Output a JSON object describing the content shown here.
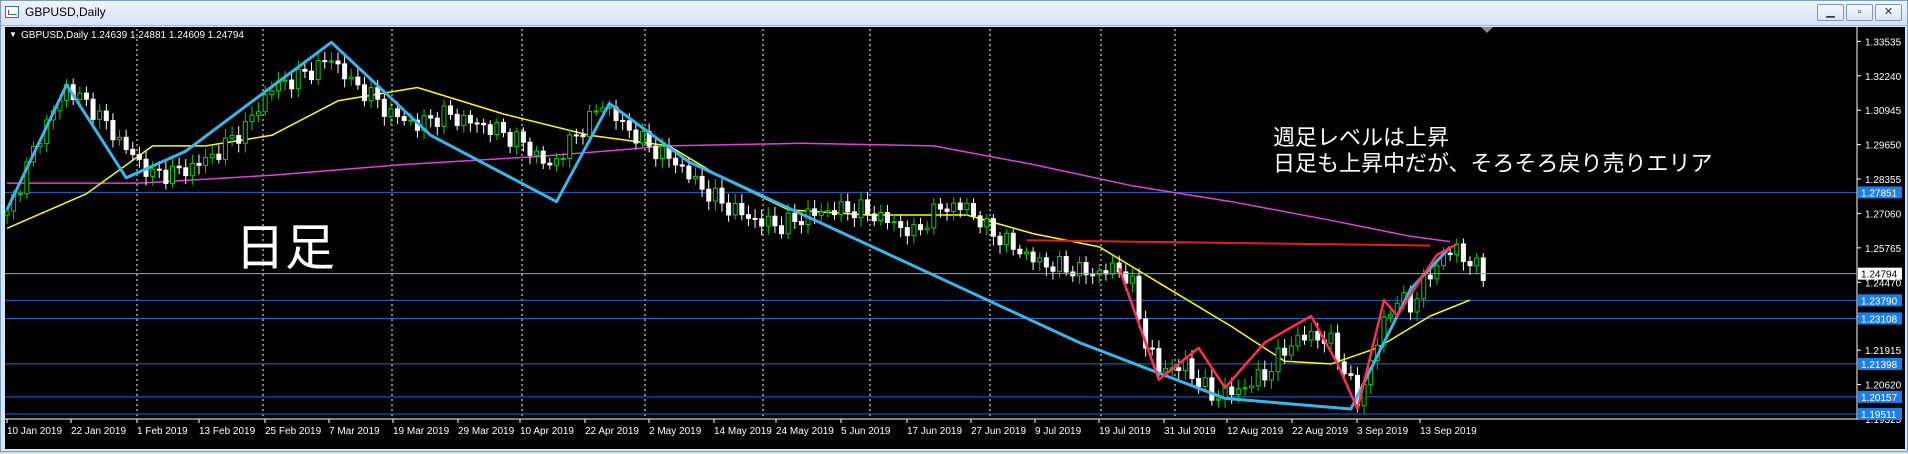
{
  "window": {
    "title": "GBPUSD,Daily",
    "minimize_icon": "minimize-icon",
    "maximize_icon": "maximize-icon",
    "close_icon": "close-icon"
  },
  "chart_data": {
    "type": "line",
    "symbol_header": "GBPUSD,Daily  1.24639 1.24881 1.24609 1.24794",
    "header_arrow_icon": "triangle-down-icon",
    "annotations": {
      "big_label": "日足",
      "note_line1": "週足レベルは上昇",
      "note_line2": "日足も上昇中だが、そろそろ戻り売りエリア"
    },
    "y_axis_ticks": [
      "1.33535",
      "1.32240",
      "1.30945",
      "1.29650",
      "1.28355",
      "1.27060",
      "1.25765",
      "1.24470",
      "1.23175",
      "1.21915",
      "1.20620",
      "1.19325"
    ],
    "ylim": [
      1.19325,
      1.34
    ],
    "x_axis_ticks": [
      "10 Jan 2019",
      "22 Jan 2019",
      "1 Feb 2019",
      "13 Feb 2019",
      "25 Feb 2019",
      "7 Mar 2019",
      "19 Mar 2019",
      "29 Mar 2019",
      "10 Apr 2019",
      "22 Apr 2019",
      "2 May 2019",
      "14 May 2019",
      "24 May 2019",
      "5 Jun 2019",
      "17 Jun 2019",
      "27 Jun 2019",
      "9 Jul 2019",
      "19 Jul 2019",
      "31 Jul 2019",
      "12 Aug 2019",
      "22 Aug 2019",
      "3 Sep 2019",
      "13 Sep 2019"
    ],
    "horizontal_levels": [
      {
        "label": "1.27851",
        "value": 1.27851
      },
      {
        "label": "1.23790",
        "value": 1.2379
      },
      {
        "label": "1.23108",
        "value": 1.23108
      },
      {
        "label": "1.21398",
        "value": 1.21398
      },
      {
        "label": "1.20157",
        "value": 1.20157
      },
      {
        "label": "1.19511",
        "value": 1.19511
      }
    ],
    "current_price": {
      "label": "1.24794",
      "value": 1.24794
    },
    "resistance_line": {
      "x_from": 154,
      "x_to": 215,
      "y_from": 1.2605,
      "y_to": 1.2585
    },
    "colors": {
      "background": "#000000",
      "grid": "#ffffff",
      "bull_candle": "#00d000",
      "bear_candle": "#ffffff",
      "zigzag_blue": "#3ab4ea",
      "ma_yellow": "#ffff00",
      "ma_magenta": "#e040e0",
      "zigzag_red": "#ff3050",
      "resistance": "#e0201c",
      "level_line": "#1e6ad0",
      "label_box": "#1e7ee8",
      "axis_text": "#ffffff"
    },
    "price_path": [
      [
        0,
        1.27
      ],
      [
        5,
        1.3
      ],
      [
        9,
        1.318
      ],
      [
        13,
        1.31
      ],
      [
        18,
        1.295
      ],
      [
        22,
        1.285
      ],
      [
        27,
        1.287
      ],
      [
        31,
        1.292
      ],
      [
        36,
        1.303
      ],
      [
        40,
        1.318
      ],
      [
        45,
        1.323
      ],
      [
        49,
        1.329
      ],
      [
        52,
        1.32
      ],
      [
        55,
        1.315
      ],
      [
        58,
        1.308
      ],
      [
        62,
        1.304
      ],
      [
        66,
        1.308
      ],
      [
        70,
        1.305
      ],
      [
        74,
        1.302
      ],
      [
        78,
        1.297
      ],
      [
        82,
        1.288
      ],
      [
        86,
        1.3
      ],
      [
        90,
        1.312
      ],
      [
        93,
        1.304
      ],
      [
        97,
        1.296
      ],
      [
        101,
        1.29
      ],
      [
        105,
        1.28
      ],
      [
        109,
        1.273
      ],
      [
        113,
        1.268
      ],
      [
        117,
        1.266
      ],
      [
        121,
        1.27
      ],
      [
        125,
        1.272
      ],
      [
        129,
        1.272
      ],
      [
        133,
        1.268
      ],
      [
        137,
        1.263
      ],
      [
        141,
        1.273
      ],
      [
        145,
        1.273
      ],
      [
        148,
        1.265
      ],
      [
        152,
        1.258
      ],
      [
        156,
        1.252
      ],
      [
        160,
        1.25
      ],
      [
        164,
        1.248
      ],
      [
        168,
        1.25
      ],
      [
        170,
        1.243
      ],
      [
        172,
        1.222
      ],
      [
        174,
        1.212
      ],
      [
        178,
        1.213
      ],
      [
        182,
        1.202
      ],
      [
        186,
        1.204
      ],
      [
        190,
        1.21
      ],
      [
        194,
        1.222
      ],
      [
        197,
        1.225
      ],
      [
        200,
        1.222
      ],
      [
        202,
        1.212
      ],
      [
        204,
        1.2
      ],
      [
        206,
        1.214
      ],
      [
        208,
        1.23
      ],
      [
        210,
        1.238
      ],
      [
        212,
        1.236
      ],
      [
        214,
        1.244
      ],
      [
        217,
        1.255
      ],
      [
        219,
        1.257
      ],
      [
        221,
        1.252
      ],
      [
        223,
        1.248
      ]
    ],
    "zigzag_blue": [
      [
        0,
        1.272
      ],
      [
        9,
        1.319
      ],
      [
        18,
        1.284
      ],
      [
        27,
        1.294
      ],
      [
        35,
        1.309
      ],
      [
        49,
        1.335
      ],
      [
        64,
        1.3
      ],
      [
        83,
        1.275
      ],
      [
        91,
        1.312
      ],
      [
        103,
        1.29
      ],
      [
        162,
        1.222
      ],
      [
        184,
        1.201
      ],
      [
        203,
        1.197
      ],
      [
        212,
        1.242
      ],
      [
        218,
        1.258
      ]
    ],
    "ma_yellow": [
      [
        0,
        1.265
      ],
      [
        12,
        1.278
      ],
      [
        22,
        1.296
      ],
      [
        30,
        1.296
      ],
      [
        40,
        1.3
      ],
      [
        50,
        1.313
      ],
      [
        62,
        1.318
      ],
      [
        75,
        1.308
      ],
      [
        88,
        1.3
      ],
      [
        100,
        1.296
      ],
      [
        108,
        1.284
      ],
      [
        118,
        1.272
      ],
      [
        130,
        1.27
      ],
      [
        145,
        1.27
      ],
      [
        155,
        1.263
      ],
      [
        165,
        1.258
      ],
      [
        175,
        1.243
      ],
      [
        185,
        1.228
      ],
      [
        193,
        1.215
      ],
      [
        200,
        1.214
      ],
      [
        207,
        1.22
      ],
      [
        215,
        1.232
      ],
      [
        221,
        1.238
      ]
    ],
    "ma_magenta": [
      [
        0,
        1.282
      ],
      [
        20,
        1.282
      ],
      [
        40,
        1.285
      ],
      [
        60,
        1.289
      ],
      [
        80,
        1.292
      ],
      [
        100,
        1.296
      ],
      [
        120,
        1.297
      ],
      [
        140,
        1.296
      ],
      [
        155,
        1.289
      ],
      [
        170,
        1.281
      ],
      [
        185,
        1.275
      ],
      [
        200,
        1.268
      ],
      [
        212,
        1.262
      ],
      [
        218,
        1.26
      ]
    ],
    "zigzag_red": [
      [
        168,
        1.25
      ],
      [
        172,
        1.222
      ],
      [
        174,
        1.208
      ],
      [
        180,
        1.22
      ],
      [
        184,
        1.205
      ],
      [
        190,
        1.222
      ],
      [
        197,
        1.232
      ],
      [
        201,
        1.214
      ],
      [
        204,
        1.197
      ],
      [
        208,
        1.238
      ],
      [
        210,
        1.232
      ],
      [
        212,
        1.24
      ],
      [
        216,
        1.255
      ],
      [
        219,
        1.259
      ]
    ]
  }
}
